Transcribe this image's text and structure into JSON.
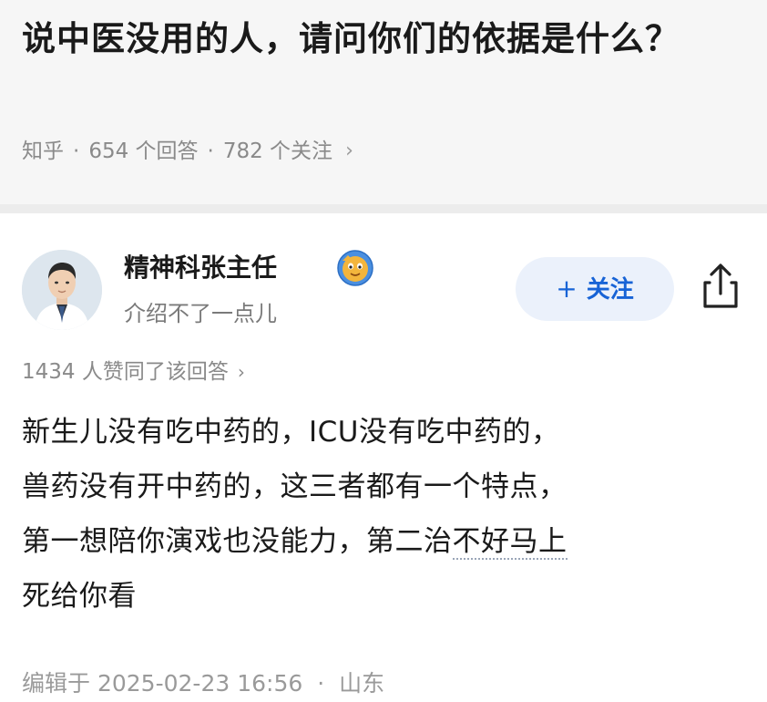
{
  "question": {
    "title": "说中医没用的人，请问你们的依据是什么？",
    "source": "知乎",
    "answers_count": "654 个回答",
    "followers_count": "782 个关注",
    "separator": "·",
    "more_chevron": "›"
  },
  "answer": {
    "author": {
      "name": "精神科张主任",
      "intro": "介绍不了一点儿",
      "avatar": "doctor-avatar",
      "badge": "verified-badge-icon"
    },
    "follow_button": {
      "plus": "+",
      "label": "关注"
    },
    "share_icon": "share-icon",
    "votes_text": "1434 人赞同了该回答",
    "votes_chevron": "›",
    "content_lines": [
      "新生儿没有吃中药的，ICU没有吃中药的，",
      "兽药没有开中药的，这三者都有一个特点，",
      "第一想陪你演戏也没能力，第二治不好马上",
      "死给你看"
    ],
    "content_line3_pre": "第一想陪你演戏也没能力，第二治",
    "content_line3_dotted": "不好马上",
    "edit_prefix": "编辑于",
    "edit_datetime": "2025-02-23 16:56",
    "edit_location": "山东"
  },
  "colors": {
    "accent": "#1763d6",
    "follow_bg": "#ebf1fb",
    "meta_gray": "#8a8a8a"
  }
}
